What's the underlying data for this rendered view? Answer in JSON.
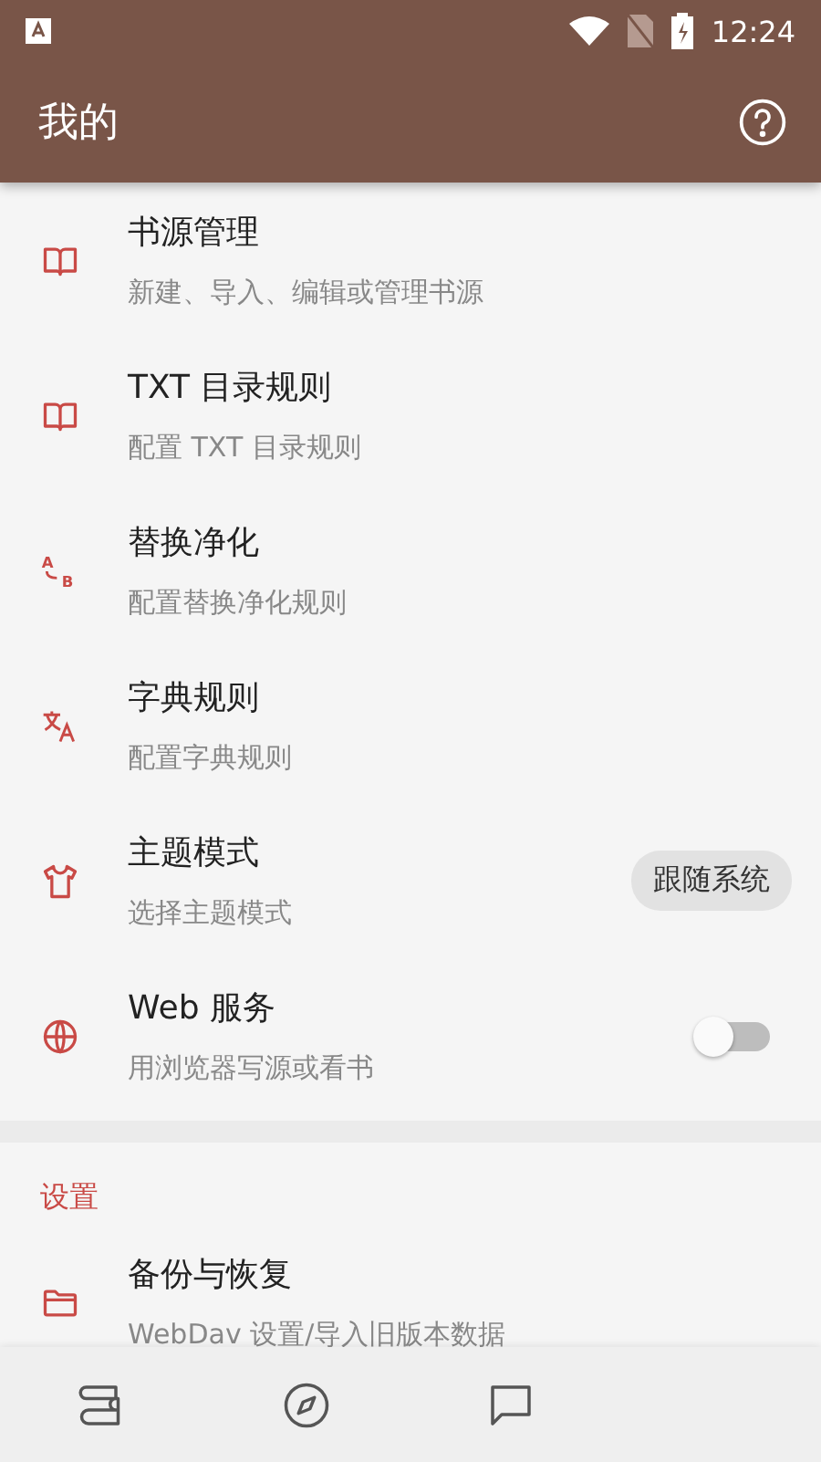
{
  "status_bar": {
    "time": "12:24"
  },
  "app_bar": {
    "title": "我的"
  },
  "items": [
    {
      "title": "书源管理",
      "subtitle": "新建、导入、编辑或管理书源",
      "kind": "plain"
    },
    {
      "title": "TXT 目录规则",
      "subtitle": "配置 TXT 目录规则",
      "kind": "plain"
    },
    {
      "title": "替换净化",
      "subtitle": "配置替换净化规则",
      "kind": "plain",
      "icon_from": "A",
      "icon_to": "B"
    },
    {
      "title": "字典规则",
      "subtitle": "配置字典规则",
      "kind": "plain"
    },
    {
      "title": "主题模式",
      "subtitle": "选择主题模式",
      "kind": "chip",
      "value": "跟随系统"
    },
    {
      "title": "Web 服务",
      "subtitle": "用浏览器写源或看书",
      "kind": "switch",
      "on": false
    }
  ],
  "settings": {
    "header": "设置",
    "items": [
      {
        "title": "备份与恢复",
        "subtitle": "WebDav 设置/导入旧版本数据"
      }
    ]
  }
}
